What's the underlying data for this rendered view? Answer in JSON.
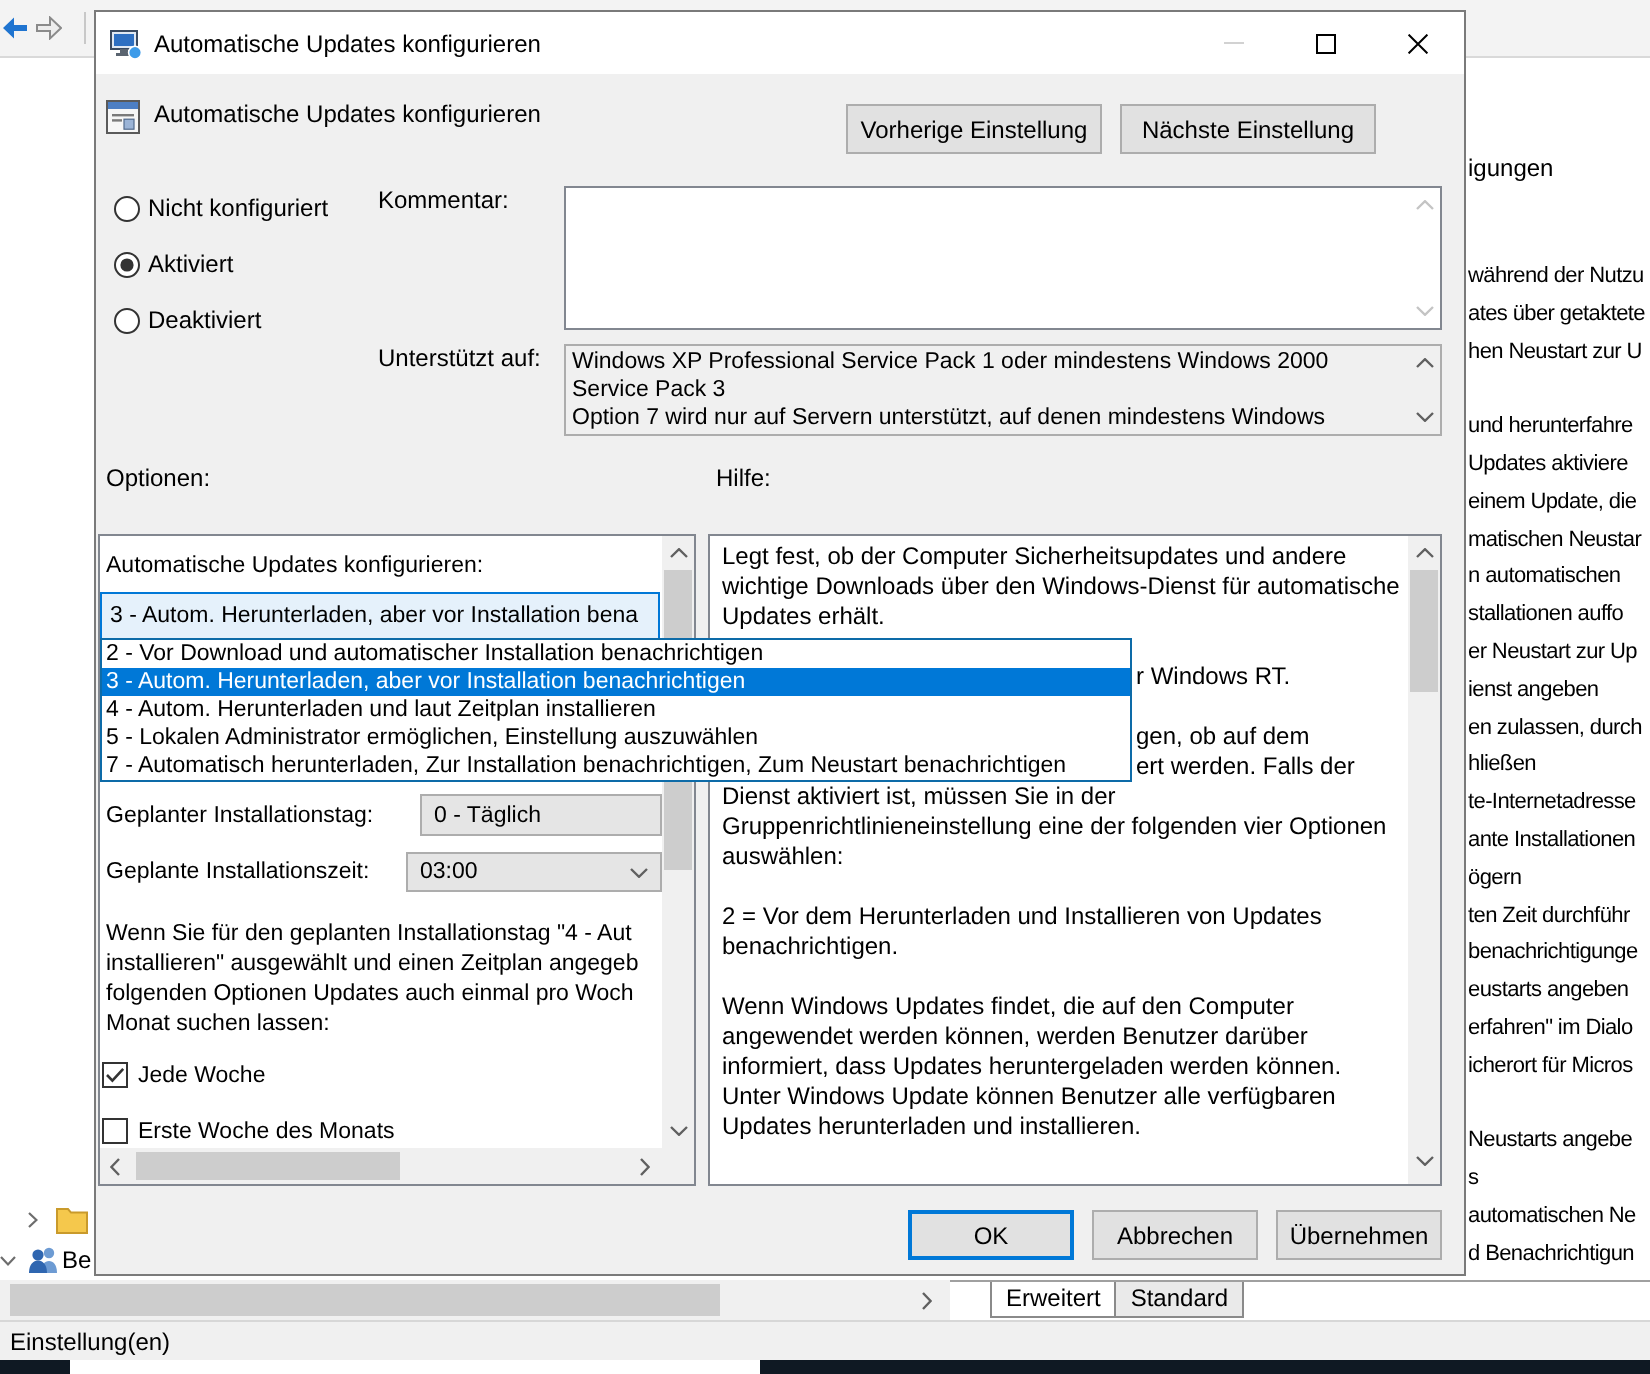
{
  "toolbar": {
    "buttons": [
      {
        "kind": "back",
        "disabled": false
      },
      {
        "kind": "forward",
        "disabled": true
      }
    ]
  },
  "tree": [
    {
      "children": [
        {
          "kind": "folder",
          "expanded": false
        }
      ]
    },
    {
      "kind": "users",
      "label": "Be",
      "expanded": true
    }
  ],
  "side_list": {
    "heading": "igungen",
    "groups": [
      {
        "rows": [
          "während der Nutzu",
          "ates über getaktete",
          "hen Neustart zur U"
        ]
      },
      {
        "rows": [
          "und herunterfahre",
          "Updates aktiviere",
          "einem Update, die",
          "matischen Neustar",
          "n automatischen",
          "stallationen auffo",
          "er Neustart zur Up",
          "ienst angeben",
          "en zulassen, durch",
          "hließen",
          "te-Internetadresse",
          "ante Installationen",
          "ögern",
          "ten Zeit durchführ",
          "benachrichtigunge",
          "eustarts angeben",
          "erfahren\" im Dialo",
          "icherort für Micros"
        ]
      },
      {
        "rows": [
          "Neustarts angebe",
          "s",
          "automatischen Ne",
          "d Benachrichtigun"
        ]
      }
    ]
  },
  "dialog": {
    "title": "Automatische Updates konfigurieren",
    "minimize_disabled": true,
    "heading": "Automatische Updates konfigurieren",
    "nav_buttons": [
      "Vorherige Einstellung",
      "Nächste Einstellung"
    ],
    "state_options": [
      {
        "label": "Nicht konfiguriert",
        "selected": false
      },
      {
        "label": "Aktiviert",
        "selected": true
      },
      {
        "label": "Deaktiviert",
        "selected": false
      }
    ],
    "comment": {
      "label": "Kommentar:"
    },
    "supported": {
      "label": "Unterstützt auf:",
      "value": "Windows XP Professional Service Pack 1 oder mindestens Windows 2000\nService Pack 3\nOption 7 wird nur auf Servern unterstützt, auf denen mindestens Windows"
    },
    "options_label": "Optionen:",
    "help_label": "Hilfe:",
    "options": {
      "combo_label": "Automatische Updates konfigurieren:",
      "combo_value": "3 - Autom. Herunterladen, aber vor Installation bena",
      "combo_expanded": true,
      "dropdown": [
        {
          "label": "2 - Vor Download und automatischer Installation benachrichtigen",
          "selected": false
        },
        {
          "label": "3 - Autom. Herunterladen, aber vor Installation benachrichtigen",
          "selected": true
        },
        {
          "label": "4 - Autom. Herunterladen und laut Zeitplan installieren",
          "selected": false
        },
        {
          "label": "5 - Lokalen Administrator ermöglichen, Einstellung auszuwählen",
          "selected": false
        },
        {
          "label": "7 - Automatisch herunterladen, Zur Installation benachrichtigen, Zum Neustart benachrichtigen",
          "selected": false
        }
      ],
      "day": {
        "label": "Geplanter Installationstag:",
        "value": "0 - Täglich"
      },
      "time": {
        "label": "Geplante Installationszeit:",
        "value": "03:00"
      },
      "note": "Wenn Sie für den geplanten Installationstag \"4 - Aut\ninstallieren\" ausgewählt und einen Zeitplan angegeb\nfolgenden Optionen Updates auch einmal pro Woch\nMonat suchen lassen:",
      "checkboxes": [
        {
          "label": "Jede Woche",
          "checked": true
        },
        {
          "label": "Erste Woche des Monats",
          "checked": false
        }
      ]
    },
    "help": [
      {
        "pieces": [
          {
            "kind": "text",
            "text": "Legt fest, ob der Computer Sicherheitsupdates und andere wichtige Downloads über den Windows-Dienst für automatische Updates erhält."
          }
        ]
      },
      {
        "pieces": [
          {
            "kind": "fragment",
            "text": "r Windows RT."
          }
        ]
      },
      {
        "pieces": [
          {
            "kind": "fragment",
            "text": "gen, ob auf dem"
          },
          {
            "kind": "fragment",
            "text": "ert werden. Falls der"
          },
          {
            "kind": "text",
            "text": "Dienst aktiviert ist, müssen Sie in der Gruppenrichtlinieneinstellung eine der folgenden vier Optionen auswählen:"
          }
        ]
      },
      {
        "pieces": [
          {
            "kind": "text",
            "text": "2 = Vor dem Herunterladen und Installieren von Updates benachrichtigen."
          }
        ]
      },
      {
        "pieces": [
          {
            "kind": "text",
            "text": "Wenn Windows Updates findet, die auf den Computer angewendet werden können, werden Benutzer darüber informiert, dass Updates heruntergeladen werden können. Unter Windows Update können Benutzer alle verfügbaren Updates herunterladen und installieren."
          }
        ]
      }
    ],
    "buttons": [
      {
        "label": "OK",
        "default": true
      },
      {
        "label": "Abbrechen",
        "default": false
      },
      {
        "label": "Übernehmen",
        "default": false
      }
    ]
  },
  "bottom_tabs": [
    {
      "label": "Erweitert",
      "selected": true
    },
    {
      "label": "Standard",
      "selected": false
    }
  ],
  "status_bar": {
    "text": "Einstellung(en)"
  }
}
